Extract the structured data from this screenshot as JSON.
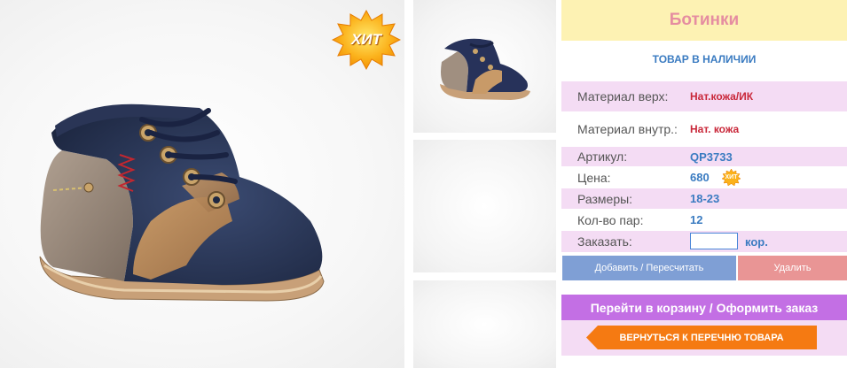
{
  "product": {
    "title": "Ботинки",
    "stock_status": "ТОВАР В НАЛИЧИИ",
    "hit_badge": "ХИТ",
    "hit_badge_small": "ХИТ",
    "specs": [
      {
        "label": "Материал верх:",
        "value": "Нат.кожа/ИК"
      },
      {
        "label": "Материал внутр.:",
        "value": "Нат. кожа"
      },
      {
        "label": "Артикул:",
        "value": "QP3733"
      },
      {
        "label": "Цена:",
        "value": "680"
      },
      {
        "label": "Размеры:",
        "value": "18-23"
      },
      {
        "label": "Кол-во пар:",
        "value": "12"
      }
    ],
    "order": {
      "label": "Заказать:",
      "quantity": "",
      "unit": "кор."
    }
  },
  "actions": {
    "add_label": "Добавить / Пересчитать",
    "delete_label": "Удалить",
    "cart_label": "Перейти в корзину / Оформить заказ",
    "back_label": "ВЕРНУТЬСЯ К ПЕРЕЧНЮ ТОВАРА"
  },
  "colors": {
    "title_bg": "#fdf2b3",
    "title_text": "#e58da1",
    "accent_blue": "#3a7bc1",
    "value_red": "#c9283a",
    "row_pink": "#f4dcf4",
    "add_button": "#7f9fd5",
    "delete_button": "#e99595",
    "cart_button": "#c36fe4",
    "back_button": "#f57a12"
  },
  "icons": {
    "hit_badge": "starburst-badge-icon",
    "back_arrow": "arrow-left-icon"
  }
}
